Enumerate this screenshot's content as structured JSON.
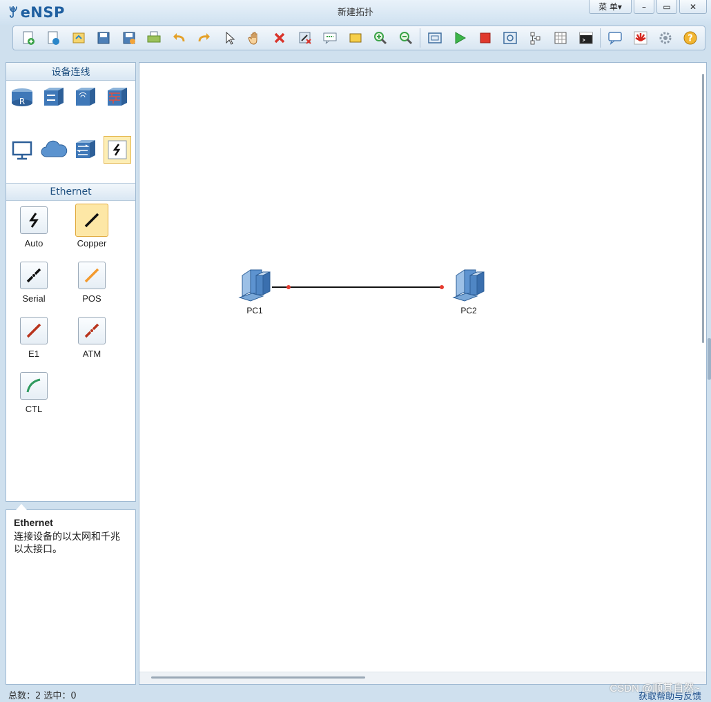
{
  "app": {
    "name": "eNSP",
    "window_title": "新建拓扑"
  },
  "window_controls": {
    "menu_label": "菜 单▾",
    "minimize": "–",
    "maximize": "▭",
    "close": "✕"
  },
  "toolbar": {
    "buttons": [
      "new-topology-icon",
      "new-example-icon",
      "open-icon",
      "save-icon",
      "save-as-icon",
      "print-icon",
      "undo-icon",
      "redo-icon",
      "select-icon",
      "pan-hand-icon",
      "delete-icon",
      "delete-link-icon",
      "text-comment-icon",
      "rectangle-icon",
      "zoom-in-icon",
      "zoom-out-icon",
      "fit-window-icon",
      "start-device-icon",
      "stop-device-icon",
      "capture-data-icon",
      "topology-icon",
      "grid-icon",
      "cli-window-icon",
      "chat-icon",
      "huawei-icon",
      "settings-icon",
      "help-icon"
    ]
  },
  "sidebar": {
    "device_panel_title": "设备连线",
    "devices": [
      "router-icon",
      "switch-icon",
      "wlan-icon",
      "firewall-icon",
      "pc-device-icon",
      "cloud-icon",
      "other-device-icon",
      "cable-category-icon"
    ],
    "cable_panel_title": "Ethernet",
    "cables": [
      {
        "label": "Auto",
        "icon": "auto-cable-icon",
        "color": "#111111"
      },
      {
        "label": "Copper",
        "icon": "copper-cable-icon",
        "color": "#111111"
      },
      {
        "label": "Serial",
        "icon": "serial-cable-icon",
        "color": "#111111"
      },
      {
        "label": "POS",
        "icon": "pos-cable-icon",
        "color": "#f39a2e"
      },
      {
        "label": "E1",
        "icon": "e1-cable-icon",
        "color": "#b8331c"
      },
      {
        "label": "ATM",
        "icon": "atm-cable-icon",
        "color": "#b8331c"
      },
      {
        "label": "CTL",
        "icon": "ctl-cable-icon",
        "color": "#2f9a5e"
      }
    ]
  },
  "info": {
    "title": "Ethernet",
    "description": "连接设备的以太网和千兆以太接口。"
  },
  "topology": {
    "devices": [
      {
        "label": "PC1"
      },
      {
        "label": "PC2"
      }
    ],
    "link_color": "#111111",
    "port_color": "#e53b2f"
  },
  "status": {
    "summary": "总数：2 选中：0",
    "right_link": "获取帮助与反馈",
    "watermark": "CSDN @顺其自然~"
  },
  "colors": {
    "accent": "#1f5fa0",
    "selected_bg": "#fdeeb5"
  }
}
